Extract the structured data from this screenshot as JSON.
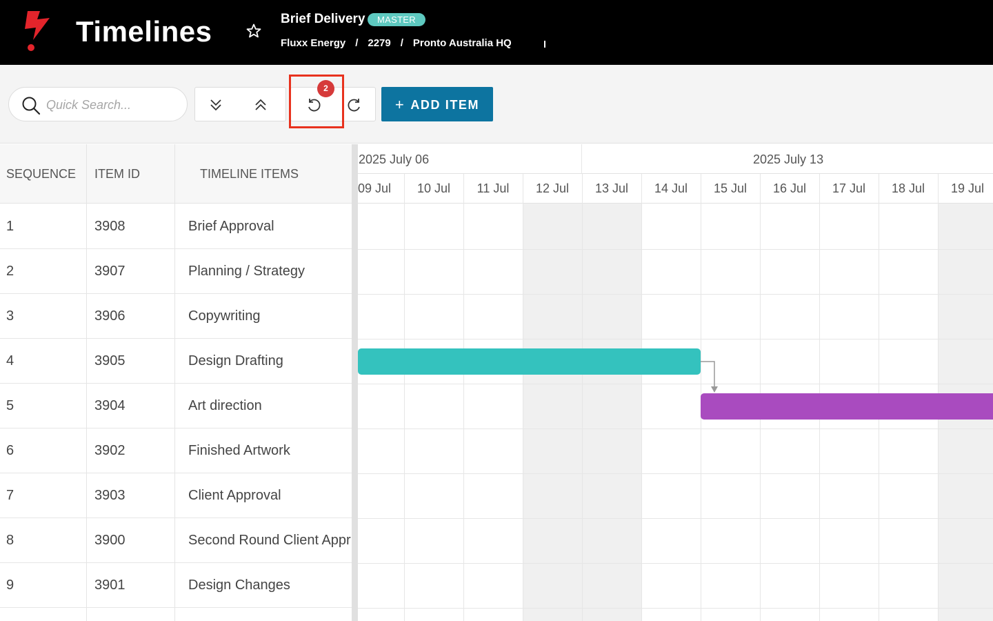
{
  "header": {
    "app_title": "Timelines",
    "project_title": "Brief Delivery",
    "badge": "MASTER",
    "breadcrumbs": [
      "Fluxx Energy",
      "2279",
      "Pronto Australia HQ"
    ],
    "crumb_separator": "/"
  },
  "toolbar": {
    "search_placeholder": "Quick Search...",
    "undo_count": "2",
    "add_item_label": "ADD ITEM"
  },
  "colors": {
    "accent_button": "#0d74a0",
    "badge_master": "#5ec9c0",
    "undo_badge": "#d63a3a",
    "bar_design_drafting": "#34c2be",
    "bar_art_direction": "#a94bbf"
  },
  "table": {
    "columns": [
      "SEQUENCE",
      "ITEM ID",
      "TIMELINE ITEMS"
    ],
    "rows": [
      {
        "sequence": "1",
        "id": "3908",
        "name": "Brief Approval"
      },
      {
        "sequence": "2",
        "id": "3907",
        "name": "Planning / Strategy"
      },
      {
        "sequence": "3",
        "id": "3906",
        "name": "Copywriting"
      },
      {
        "sequence": "4",
        "id": "3905",
        "name": "Design Drafting"
      },
      {
        "sequence": "5",
        "id": "3904",
        "name": "Art direction"
      },
      {
        "sequence": "6",
        "id": "3902",
        "name": "Finished Artwork"
      },
      {
        "sequence": "7",
        "id": "3903",
        "name": "Client Approval"
      },
      {
        "sequence": "8",
        "id": "3900",
        "name": "Second Round Client Approval"
      },
      {
        "sequence": "9",
        "id": "3901",
        "name": "Design Changes"
      }
    ]
  },
  "gantt": {
    "weeks": [
      "2025 July 06",
      "2025 July 13"
    ],
    "days": [
      "09 Jul",
      "10 Jul",
      "11 Jul",
      "12 Jul",
      "13 Jul",
      "14 Jul",
      "15 Jul",
      "16 Jul",
      "17 Jul",
      "18 Jul",
      "19 Jul"
    ],
    "weekend_days": [
      "12 Jul",
      "13 Jul",
      "19 Jul"
    ]
  }
}
